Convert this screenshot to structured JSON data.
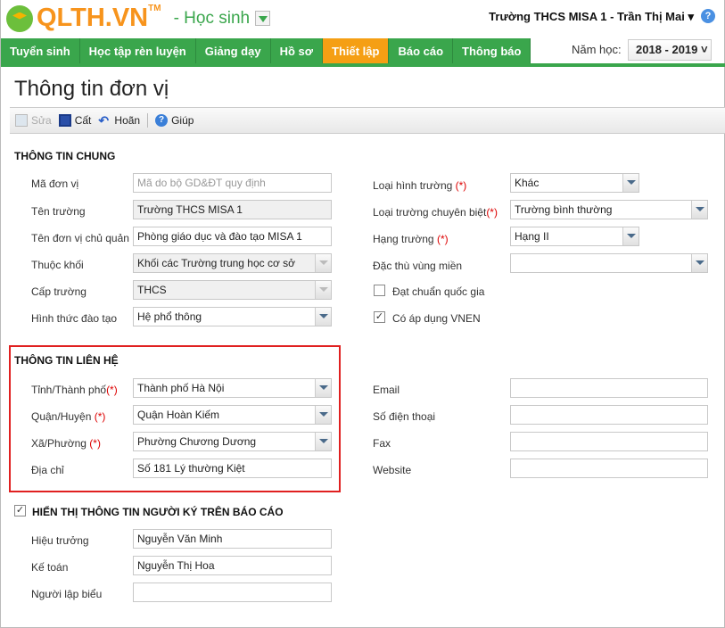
{
  "header": {
    "logo": "QLTH.VN",
    "tm": "TM",
    "role": "- Học sinh",
    "user": "Trường THCS MISA 1 - Trần Thị Mai ▾",
    "help": "?"
  },
  "nav": [
    "Tuyển sinh",
    "Học tập rèn luyện",
    "Giảng dạy",
    "Hồ sơ",
    "Thiết lập",
    "Báo cáo",
    "Thông báo"
  ],
  "nav_active": "Thiết lập",
  "year": {
    "label": "Năm học:",
    "value": "2018 - 2019 ˅"
  },
  "page_title": "Thông tin đơn vị",
  "toolbar": {
    "edit": "Sửa",
    "save": "Cất",
    "undo": "Hoãn",
    "help": "Giúp"
  },
  "general": {
    "title": "THÔNG TIN CHUNG",
    "left": [
      {
        "label": "Mã đơn vị",
        "value": "Mã do bộ GD&ĐT quy định"
      },
      {
        "label": "Tên trường",
        "value": "Trường THCS MISA 1"
      },
      {
        "label": "Tên đơn vị chủ quản",
        "value": "Phòng giáo dục và đào tạo MISA 1"
      },
      {
        "label": "Thuộc khối",
        "value": "Khối các Trường trung học cơ sở"
      },
      {
        "label": "Cấp trường",
        "value": "THCS"
      },
      {
        "label": "Hình thức đào tạo",
        "value": "Hệ phổ thông"
      }
    ],
    "right": [
      {
        "label": "Loại hình trường",
        "value": "Khác"
      },
      {
        "label": "Loại trường chuyên biệt",
        "value": "Trường bình thường"
      },
      {
        "label": "Hạng trường",
        "value": "Hạng II"
      },
      {
        "label": "Đặc thù vùng miền",
        "value": ""
      },
      {
        "label": "Đạt chuẩn quốc gia",
        "checked": false
      },
      {
        "label": "Có áp dụng VNEN",
        "checked": true
      }
    ]
  },
  "required_mark": "(*)",
  "contact": {
    "title": "THÔNG TIN LIÊN HỆ",
    "left": [
      {
        "label": "Tỉnh/Thành phố",
        "value": "Thành phố Hà Nội"
      },
      {
        "label": "Quận/Huyện",
        "value": "Quận Hoàn Kiếm"
      },
      {
        "label": "Xã/Phường",
        "value": "Phường Chương Dương"
      },
      {
        "label": "Địa chỉ",
        "value": "Số 181 Lý thường Kiệt"
      }
    ],
    "right": [
      {
        "label": "Email",
        "value": ""
      },
      {
        "label": "Số điện thoại",
        "value": ""
      },
      {
        "label": "Fax",
        "value": ""
      },
      {
        "label": "Website",
        "value": ""
      }
    ]
  },
  "signer": {
    "title": "HIỂN THỊ THÔNG TIN NGƯỜI KÝ TRÊN BÁO CÁO",
    "checked": true,
    "rows": [
      {
        "label": "Hiệu trưởng",
        "value": "Nguyễn Văn Minh"
      },
      {
        "label": "Kế toán",
        "value": "Nguyễn Thị Hoa"
      },
      {
        "label": "Người lập biểu",
        "value": ""
      }
    ]
  }
}
